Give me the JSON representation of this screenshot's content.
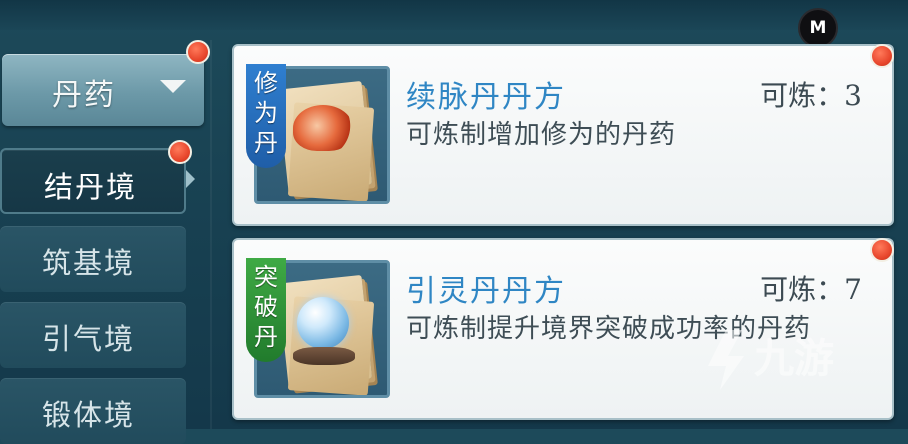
{
  "header": {
    "avatar_letter": "M"
  },
  "sidebar": {
    "dropdown_label": "丹药",
    "items": [
      {
        "label": "结丹境",
        "active": true
      },
      {
        "label": "筑基境",
        "active": false
      },
      {
        "label": "引气境",
        "active": false
      },
      {
        "label": "锻体境",
        "active": false
      }
    ]
  },
  "recipes": [
    {
      "tag": "修为丹",
      "tag_color": "#2f7fd0",
      "title": "续脉丹丹方",
      "count": "可炼：3",
      "desc": "可炼制增加修为的丹药",
      "icon": "scroll-flame-icon"
    },
    {
      "tag": "突破丹",
      "tag_color": "#3faa45",
      "title": "引灵丹丹方",
      "count": "可炼：7",
      "desc": "可炼制提升境界突破成功率的丹药",
      "icon": "scroll-orb-icon"
    }
  ],
  "watermark": {
    "text": "九游"
  },
  "colors": {
    "notification_dot": "#e8472d",
    "title_blue": "#2f86c4",
    "background": "#1d4a5a"
  }
}
